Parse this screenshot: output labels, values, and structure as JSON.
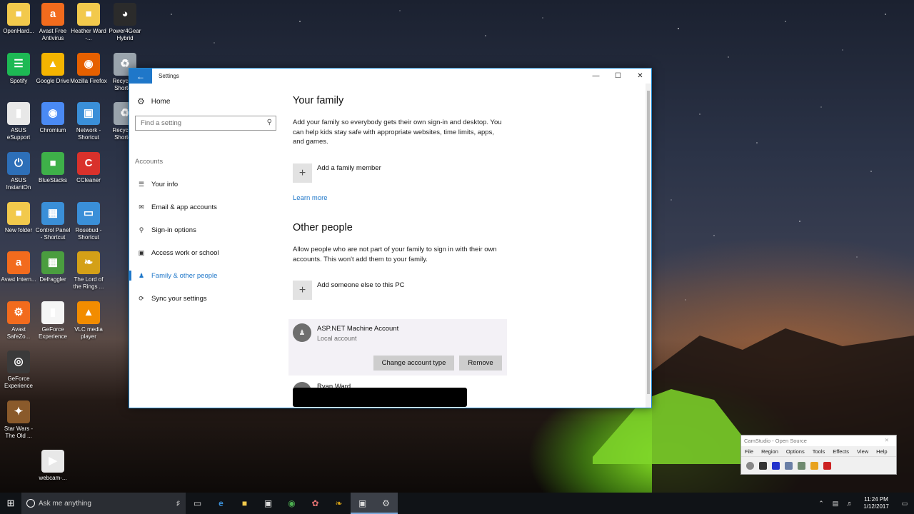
{
  "desktop": {
    "icons": [
      {
        "label": "OpenHard...",
        "icon": "folder-icon",
        "color": "#f2c94c"
      },
      {
        "label": "Avast Free Antivirus",
        "icon": "avast-icon",
        "color": "#f26b1d"
      },
      {
        "label": "Heather Ward -...",
        "icon": "folder-icon",
        "color": "#f2c94c"
      },
      {
        "label": "Power4Gear Hybrid",
        "icon": "gauge-icon",
        "color": "#2b2b2b"
      },
      {
        "label": "Spotify",
        "icon": "spotify-icon",
        "color": "#1db954"
      },
      {
        "label": "Google Drive",
        "icon": "drive-icon",
        "color": "#f4b400"
      },
      {
        "label": "Mozilla Firefox",
        "icon": "firefox-icon",
        "color": "#e66000"
      },
      {
        "label": "Recycle... Shortc...",
        "icon": "recycle-bin-icon",
        "color": "#9aa4ad"
      },
      {
        "label": "ASUS eSupport",
        "icon": "document-icon",
        "color": "#e8e8e8"
      },
      {
        "label": "Chromium",
        "icon": "chromium-icon",
        "color": "#4a8af4"
      },
      {
        "label": "Network - Shortcut",
        "icon": "network-icon",
        "color": "#3a8fd8"
      },
      {
        "label": "Recycle... Shortc...",
        "icon": "recycle-bin-icon",
        "color": "#9aa4ad"
      },
      {
        "label": "ASUS InstantOn",
        "icon": "power-icon",
        "color": "#2d6fb8"
      },
      {
        "label": "BlueStacks",
        "icon": "bluestacks-icon",
        "color": "#3eb049"
      },
      {
        "label": "CCleaner",
        "icon": "ccleaner-icon",
        "color": "#d9312b"
      },
      {
        "label": "New folder",
        "icon": "folder-icon",
        "color": "#f2c94c"
      },
      {
        "label": "Control Panel - Shortcut",
        "icon": "control-panel-icon",
        "color": "#3a8fd8"
      },
      {
        "label": "Rosebud - Shortcut",
        "icon": "monitor-icon",
        "color": "#3a8fd8"
      },
      {
        "label": "Avast Intern...",
        "icon": "avast-icon",
        "color": "#f26b1d"
      },
      {
        "label": "Defraggler",
        "icon": "defraggler-icon",
        "color": "#4a9d3f"
      },
      {
        "label": "The Lord of the Rings ...",
        "icon": "ring-icon",
        "color": "#d4a017"
      },
      {
        "label": "Avast SafeZo...",
        "icon": "safezone-icon",
        "color": "#f26b1d"
      },
      {
        "label": "GeForce Experience",
        "icon": "document-icon",
        "color": "#f5f5f5"
      },
      {
        "label": "VLC media player",
        "icon": "vlc-icon",
        "color": "#f28c00"
      },
      {
        "label": "GeForce Experience",
        "icon": "geforce-icon",
        "color": "#3a3a3a"
      },
      {
        "label": "Star Wars - The Old ...",
        "icon": "star-wars-icon",
        "color": "#8a5a2b"
      },
      {
        "label": "webcam-...",
        "icon": "video-file-icon",
        "color": "#e8e8e8"
      }
    ]
  },
  "window": {
    "title": "Settings",
    "accent": "#1f77c9"
  },
  "sidebar": {
    "home": "Home",
    "search_placeholder": "Find a setting",
    "section": "Accounts",
    "items": [
      {
        "label": "Your info",
        "icon": "person-card-icon"
      },
      {
        "label": "Email & app accounts",
        "icon": "mail-icon"
      },
      {
        "label": "Sign-in options",
        "icon": "key-icon"
      },
      {
        "label": "Access work or school",
        "icon": "briefcase-icon"
      },
      {
        "label": "Family & other people",
        "icon": "person-icon",
        "active": true
      },
      {
        "label": "Sync your settings",
        "icon": "sync-icon"
      }
    ]
  },
  "main": {
    "family_title": "Your family",
    "family_desc": "Add your family so everybody gets their own sign-in and desktop. You can help kids stay safe with appropriate websites, time limits, apps, and games.",
    "add_family": "Add a family member",
    "learn_more": "Learn more",
    "other_title": "Other people",
    "other_desc": "Allow people who are not part of your family to sign in with their own accounts. This won't add them to your family.",
    "add_someone": "Add someone else to this PC",
    "account1_name": "ASP.NET Machine Account",
    "account1_type": "Local account",
    "change_type": "Change account type",
    "remove": "Remove",
    "account2_name": "Ryan Ward"
  },
  "camstudio": {
    "title": "CamStudio - Open Source",
    "menu": [
      "File",
      "Region",
      "Options",
      "Tools",
      "Effects",
      "View",
      "Help"
    ]
  },
  "taskbar": {
    "search_placeholder": "Ask me anything",
    "time": "11:24 PM",
    "date": "1/12/2017"
  }
}
